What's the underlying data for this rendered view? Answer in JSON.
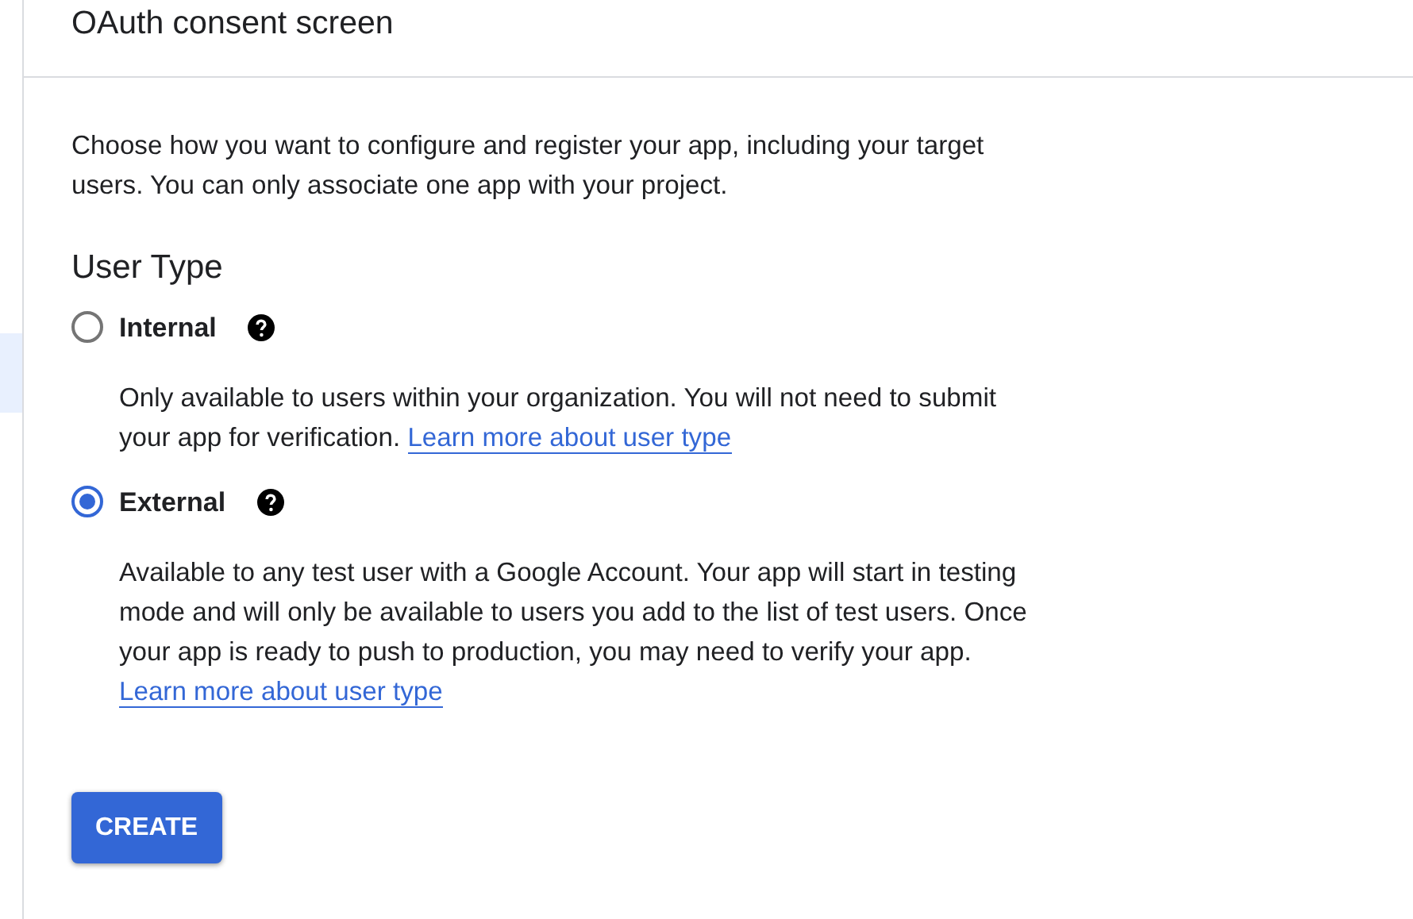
{
  "sidebar": {
    "items": [
      {
        "selected": true
      }
    ]
  },
  "header": {
    "title": "OAuth consent screen"
  },
  "intro": "Choose how you want to configure and register your app, including your target users. You can only associate one app with your project.",
  "user_type": {
    "heading": "User Type",
    "options": [
      {
        "label": "Internal",
        "selected": false,
        "description": "Only available to users within your organization. You will not need to submit your app for verification.",
        "link": "Learn more about user type"
      },
      {
        "label": "External",
        "selected": true,
        "description": "Available to any test user with a Google Account. Your app will start in testing mode and will only be available to users you add to the list of test users. Once your app is ready to push to production, you may need to verify your app.",
        "link": "Learn more about user type"
      }
    ]
  },
  "buttons": [
    {
      "label": "CREATE"
    }
  ]
}
